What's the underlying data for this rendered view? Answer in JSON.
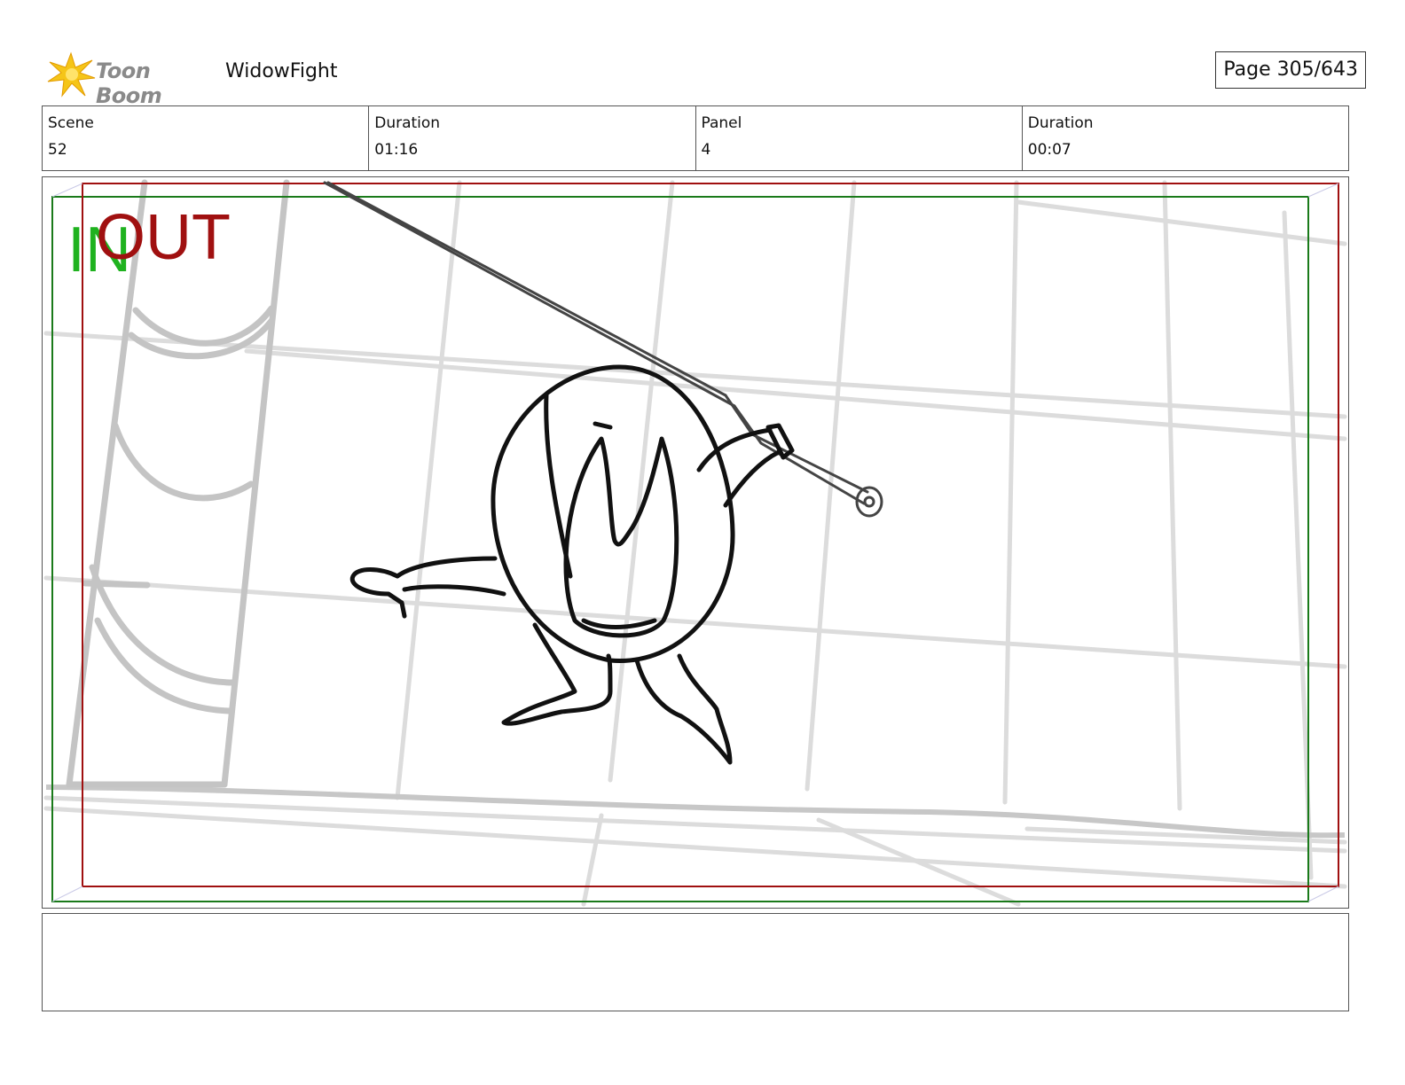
{
  "header": {
    "brand": "Toon Boom",
    "project_title": "WidowFight",
    "page_label": "Page 305/643"
  },
  "info": {
    "scene_label": "Scene",
    "scene_value": "52",
    "scene_duration_label": "Duration",
    "scene_duration_value": "01:16",
    "panel_label": "Panel",
    "panel_value": "4",
    "panel_duration_label": "Duration",
    "panel_duration_value": "00:07"
  },
  "panel": {
    "in_marker": "IN",
    "out_marker": "OUT",
    "in_frame_color": "#1a7a1a",
    "out_frame_color": "#a01010"
  },
  "notes": {
    "text": ""
  },
  "icons": {
    "logo": "toon-boom-burst-icon"
  }
}
